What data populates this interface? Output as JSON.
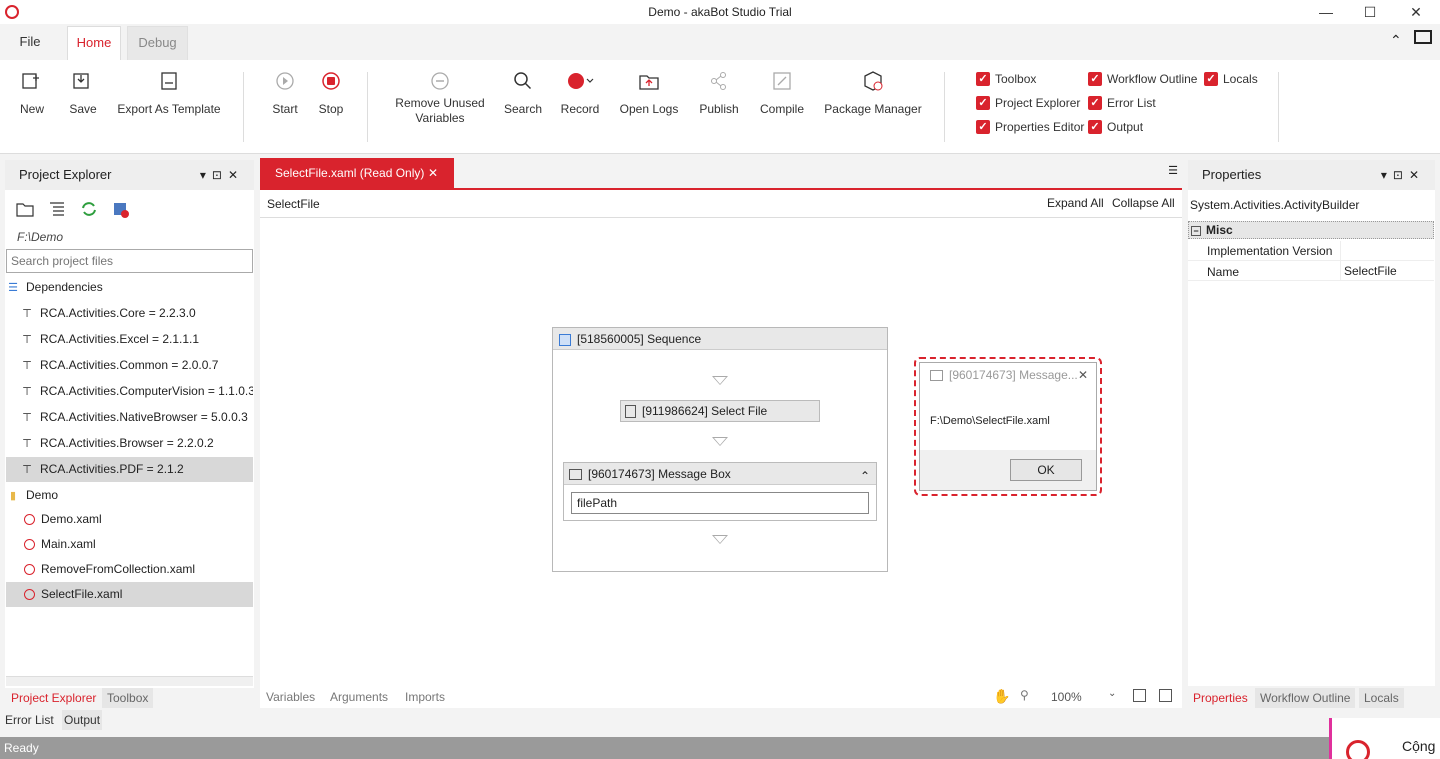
{
  "window": {
    "title": "Demo - akaBot Studio Trial"
  },
  "ribbon_tabs": [
    {
      "label": "File"
    },
    {
      "label": "Home"
    },
    {
      "label": "Debug"
    }
  ],
  "ribbon": {
    "buttons": {
      "new": "New",
      "save": "Save",
      "export": "Export As Template",
      "start": "Start",
      "stop": "Stop",
      "remove_unused_1": "Remove Unused",
      "remove_unused_2": "Variables",
      "search": "Search",
      "record": "Record",
      "open_logs": "Open Logs",
      "publish": "Publish",
      "compile": "Compile",
      "package_manager": "Package Manager"
    },
    "checkboxes": {
      "toolbox": "Toolbox",
      "workflow_outline": "Workflow Outline",
      "locals": "Locals",
      "project_explorer": "Project Explorer",
      "error_list": "Error List",
      "properties_editor": "Properties Editor",
      "output": "Output"
    }
  },
  "project_explorer": {
    "title": "Project Explorer",
    "path": "F:\\Demo",
    "search_placeholder": "Search project files",
    "dependencies_label": "Dependencies",
    "dependencies": [
      "RCA.Activities.Core = 2.2.3.0",
      "RCA.Activities.Excel = 2.1.1.1",
      "RCA.Activities.Common = 2.0.0.7",
      "RCA.Activities.ComputerVision = 1.1.0.3",
      "RCA.Activities.NativeBrowser = 5.0.0.3",
      "RCA.Activities.Browser = 2.2.0.2",
      "RCA.Activities.PDF = 2.1.2"
    ],
    "folder": "Demo",
    "files": [
      "Demo.xaml",
      "Main.xaml",
      "RemoveFromCollection.xaml",
      "SelectFile.xaml"
    ],
    "bottom_tabs": [
      "Project Explorer",
      "Toolbox"
    ]
  },
  "bottom_tabs": [
    "Error List",
    "Output"
  ],
  "document": {
    "tab_label": "SelectFile.xaml (Read Only)",
    "breadcrumb": "SelectFile",
    "expand_all": "Expand All",
    "collapse_all": "Collapse All"
  },
  "workflow": {
    "sequence_title": "[518560005] Sequence",
    "select_file": "[911986624] Select File",
    "message_box": "[960174673] Message Box",
    "message_box_value": "filePath"
  },
  "designer_footer": {
    "variables": "Variables",
    "arguments": "Arguments",
    "imports": "Imports",
    "zoom": "100%"
  },
  "message_dialog": {
    "title": "[960174673] Message...",
    "text": "F:\\Demo\\SelectFile.xaml",
    "ok": "OK"
  },
  "properties": {
    "title": "Properties",
    "type": "System.Activities.ActivityBuilder",
    "category": "Misc",
    "rows": [
      {
        "name": "Implementation Version",
        "value": ""
      },
      {
        "name": "Name",
        "value": "SelectFile"
      }
    ],
    "bottom_tabs": [
      "Properties",
      "Workflow Outline",
      "Locals"
    ]
  },
  "statusbar": {
    "text": "Ready"
  },
  "notification": {
    "text": "Cộng"
  },
  "colors": {
    "accent": "#d9232d",
    "status": "#9a9a9a"
  }
}
